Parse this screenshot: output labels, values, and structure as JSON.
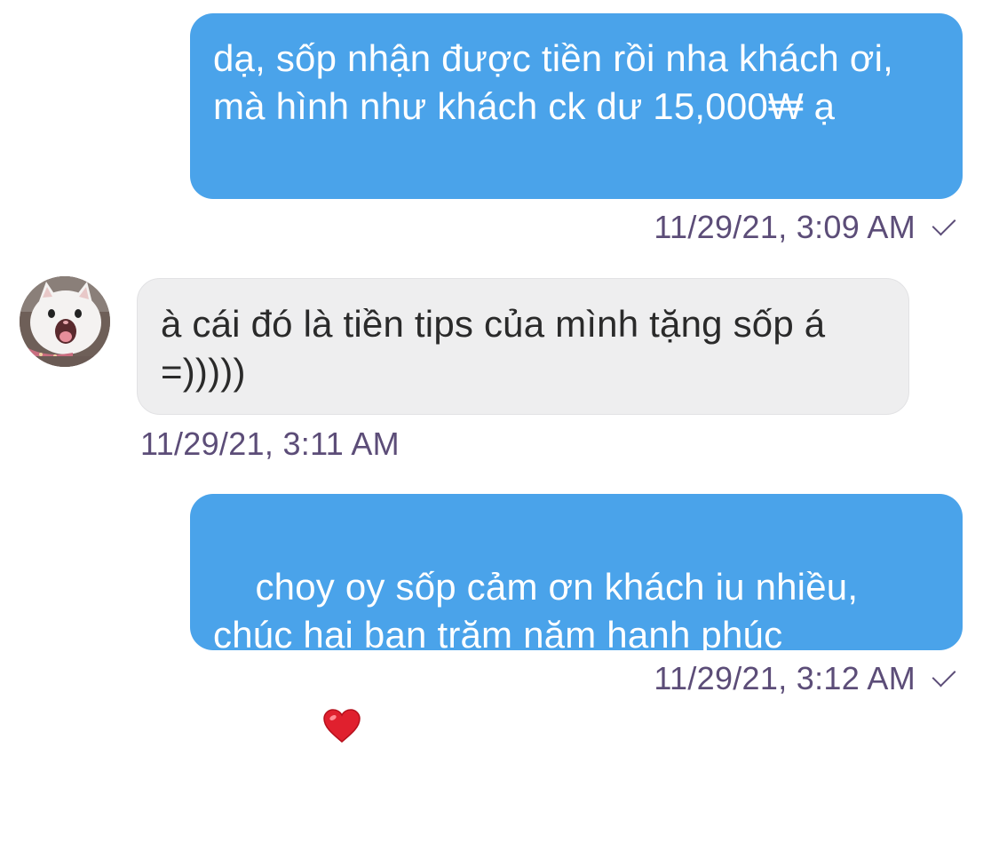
{
  "messages": [
    {
      "direction": "outgoing",
      "text": "dạ, sốp nhận được tiền rồi nha khách ơi, mà hình như khách ck dư 15,000₩ ạ",
      "timestamp": "11/29/21, 3:09 AM",
      "status_icon": "check-icon"
    },
    {
      "direction": "incoming",
      "avatar_icon": "white-cat-avatar",
      "text": "à cái đó là tiền tips của mình tặng sốp á =)))))",
      "timestamp": "11/29/21, 3:11 AM"
    },
    {
      "direction": "outgoing",
      "text": "choy oy sốp cảm ơn khách iu nhiều, chúc hai bạn trăm năm hạnh phúc",
      "emoji": "❤️",
      "emoji_icon": "red-heart-icon",
      "timestamp": "11/29/21, 3:12 AM",
      "status_icon": "check-icon"
    }
  ],
  "colors": {
    "outgoing_bubble": "#4aa3ea",
    "incoming_bubble": "#eeeeef",
    "timestamp_text": "#5c4d78"
  }
}
